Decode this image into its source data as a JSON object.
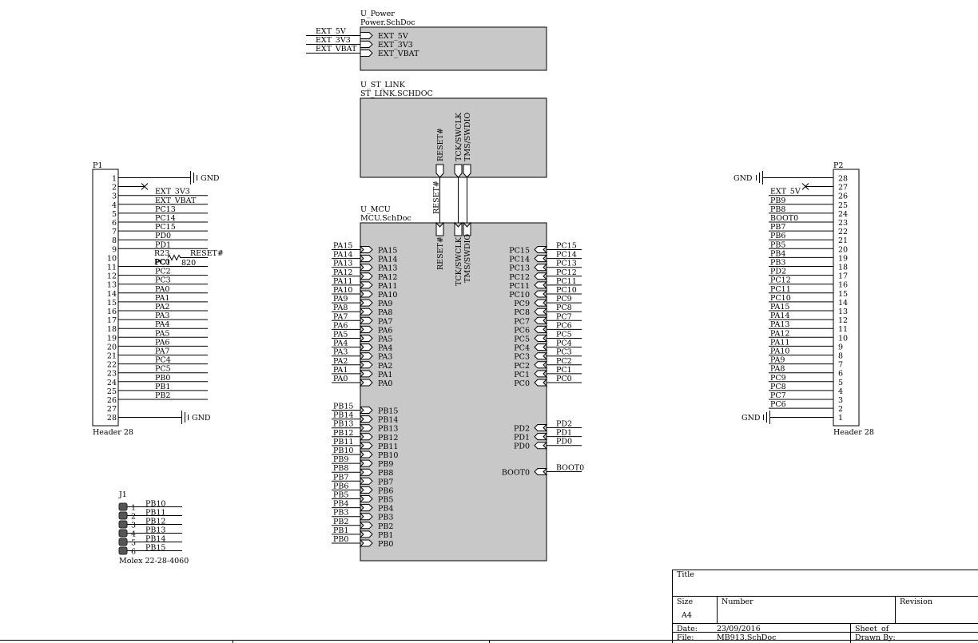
{
  "sheets": {
    "power": {
      "designator": "U_Power",
      "file": "Power.SchDoc",
      "ports": [
        "EXT_5V",
        "EXT_3V3",
        "EXT_VBAT"
      ]
    },
    "stlink": {
      "designator": "U_ST_LINK",
      "file": "ST_LINK.SCHDOC",
      "ports": [
        "RESET#",
        "TCK/SWCLK",
        "TMS/SWDIO"
      ]
    },
    "mcu": {
      "designator": "U_MCU",
      "file": "MCU.SchDoc",
      "top_ports": [
        "RESET#",
        "TCK/SWCLK",
        "TMS/SWDIO"
      ],
      "left_a": [
        "PA15",
        "PA14",
        "PA13",
        "PA12",
        "PA11",
        "PA10",
        "PA9",
        "PA8",
        "PA7",
        "PA6",
        "PA5",
        "PA4",
        "PA3",
        "PA2",
        "PA1",
        "PA0"
      ],
      "left_b": [
        "PB15",
        "PB14",
        "PB13",
        "PB12",
        "PB11",
        "PB10",
        "PB9",
        "PB8",
        "PB7",
        "PB6",
        "PB5",
        "PB4",
        "PB3",
        "PB2",
        "PB1",
        "PB0"
      ],
      "right_c": [
        "PC15",
        "PC14",
        "PC13",
        "PC12",
        "PC11",
        "PC10",
        "PC9",
        "PC8",
        "PC7",
        "PC6",
        "PC5",
        "PC4",
        "PC3",
        "PC2",
        "PC1",
        "PC0"
      ],
      "right_d": [
        "PD2",
        "PD1",
        "PD0"
      ],
      "right_boot": [
        "BOOT0"
      ]
    }
  },
  "nets": {
    "power_nets": [
      "EXT_5V",
      "EXT_3V3",
      "EXT_VBAT"
    ],
    "reset_net": "RESET#",
    "mcu_left_a": [
      "PA15",
      "PA14",
      "PA13",
      "PA12",
      "PA11",
      "PA10",
      "PA9",
      "PA8",
      "PA7",
      "PA6",
      "PA5",
      "PA4",
      "PA3",
      "PA2",
      "PA1",
      "PA0"
    ],
    "mcu_left_b": [
      "PB15",
      "PB14",
      "PB13",
      "PB12",
      "PB11",
      "PB10",
      "PB9",
      "PB8",
      "PB7",
      "PB6",
      "PB5",
      "PB4",
      "PB3",
      "PB2",
      "PB1",
      "PB0"
    ],
    "mcu_right_c": [
      "PC15",
      "PC14",
      "PC13",
      "PC12",
      "PC11",
      "PC10",
      "PC9",
      "PC8",
      "PC7",
      "PC6",
      "PC5",
      "PC4",
      "PC3",
      "PC2",
      "PC1",
      "PC0"
    ],
    "mcu_right_d": [
      "PD2",
      "PD1",
      "PD0"
    ],
    "mcu_right_boot": [
      "BOOT0"
    ]
  },
  "p1": {
    "designator": "P1",
    "comment": "Header 28",
    "pins": [
      "1",
      "2",
      "3",
      "4",
      "5",
      "6",
      "7",
      "8",
      "9",
      "10",
      "11",
      "12",
      "13",
      "14",
      "15",
      "16",
      "17",
      "18",
      "19",
      "20",
      "21",
      "22",
      "23",
      "24",
      "25",
      "26",
      "27",
      "28"
    ],
    "nets": [
      "",
      "",
      "EXT_3V3",
      "EXT_VBAT",
      "PC13",
      "PC14",
      "PC15",
      "PD0",
      "PD1",
      "",
      "PC1",
      "PC2",
      "PC3",
      "PA0",
      "PA1",
      "PA2",
      "PA3",
      "PA4",
      "PA5",
      "PA6",
      "PA7",
      "PC4",
      "PC5",
      "PB0",
      "PB1",
      "PB2",
      "",
      ""
    ],
    "gnd_label": "GND",
    "resistor": {
      "designator": "R23",
      "value": "820",
      "net_in": "PC0",
      "net_out": "RESET#"
    }
  },
  "p2": {
    "designator": "P2",
    "comment": "Header 28",
    "pins": [
      "28",
      "27",
      "26",
      "25",
      "24",
      "23",
      "22",
      "21",
      "20",
      "19",
      "18",
      "17",
      "16",
      "15",
      "14",
      "13",
      "12",
      "11",
      "10",
      "9",
      "8",
      "7",
      "6",
      "5",
      "4",
      "3",
      "2",
      "1"
    ],
    "nets": [
      "",
      "",
      "EXT_5V",
      "PB9",
      "PB8",
      "BOOT0",
      "PB7",
      "PB6",
      "PB5",
      "PB4",
      "PB3",
      "PD2",
      "PC12",
      "PC11",
      "PC10",
      "PA15",
      "PA14",
      "PA13",
      "PA12",
      "PA11",
      "PA10",
      "PA9",
      "PA8",
      "PC9",
      "PC8",
      "PC7",
      "PC6",
      ""
    ],
    "gnd_label": "GND"
  },
  "j1": {
    "designator": "J1",
    "comment": "Molex 22-28-4060",
    "pins": [
      "1",
      "2",
      "3",
      "4",
      "5",
      "6"
    ],
    "nets": [
      "PB10",
      "PB11",
      "PB12",
      "PB13",
      "PB14",
      "PB15"
    ]
  },
  "title_block": {
    "title_label": "Title",
    "size_label": "Size",
    "size_value": "A4",
    "number_label": "Number",
    "revision_label": "Revision",
    "date_label": "Date:",
    "date_value": "23/09/2016",
    "sheet_label": "Sheet",
    "of_label": "of",
    "file_label": "File:",
    "file_value": "MB913.SchDoc",
    "drawn_label": "Drawn By:"
  }
}
